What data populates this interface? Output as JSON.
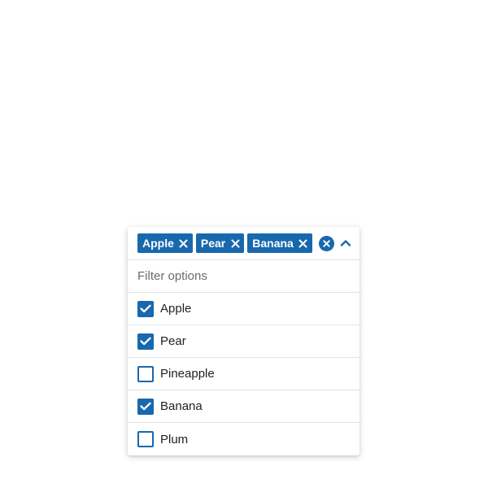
{
  "colors": {
    "accent": "#1868ad",
    "border": "#e3e3e3",
    "text": "#222222",
    "placeholder": "#6b6b6b"
  },
  "selected_chips": [
    {
      "label": "Apple",
      "icon": "close-icon"
    },
    {
      "label": "Pear",
      "icon": "close-icon"
    },
    {
      "label": "Banana",
      "icon": "close-icon"
    }
  ],
  "controls": {
    "clear_all_icon": "circle-close-icon",
    "toggle_icon": "chevron-up-icon"
  },
  "filter": {
    "placeholder": "Filter options",
    "value": ""
  },
  "options": [
    {
      "label": "Apple",
      "checked": true
    },
    {
      "label": "Pear",
      "checked": true
    },
    {
      "label": "Pineapple",
      "checked": false
    },
    {
      "label": "Banana",
      "checked": true
    },
    {
      "label": "Plum",
      "checked": false
    }
  ]
}
